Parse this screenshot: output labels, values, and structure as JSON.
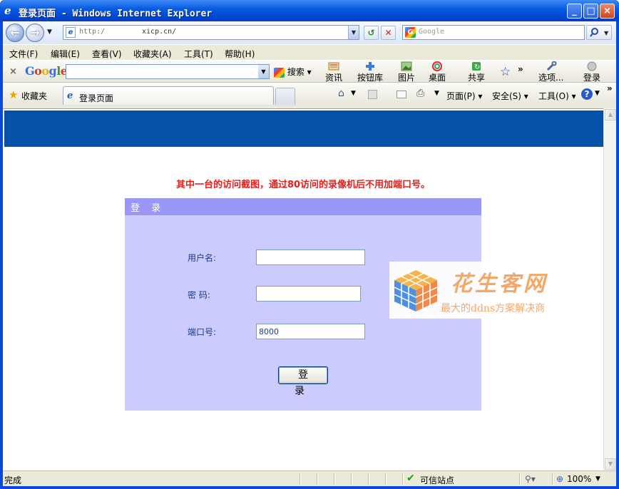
{
  "window": {
    "title": "登录页面 - Windows Internet Explorer",
    "controls": [
      "_",
      "□",
      "×"
    ]
  },
  "address_bar": {
    "url_prefix": "http:/",
    "url_host": "xicp.cn/",
    "search_placeholder": "Google"
  },
  "menu": {
    "items": [
      "文件(F)",
      "编辑(E)",
      "查看(V)",
      "收藏夹(A)",
      "工具(T)",
      "帮助(H)"
    ]
  },
  "google_toolbar": {
    "logo": "Google",
    "search_label": "搜索",
    "buttons": [
      "资讯",
      "按钮库",
      "图片",
      "桌面",
      "共享",
      "选项...",
      "登录"
    ]
  },
  "favorites_bar": {
    "favorites_label": "收藏夹",
    "tab_label": "登录页面",
    "tools": [
      "页面(P)",
      "安全(S)",
      "工具(O)"
    ]
  },
  "page": {
    "notice": "其中一台的访问截图，通过80访问的录像机后不用加端口号。",
    "login_header": "登 录",
    "username_label": "用户名:",
    "password_label": "密  码:",
    "port_label": "端口号:",
    "username_value": "",
    "password_value": "",
    "port_value": "8000",
    "login_button": "登 录"
  },
  "watermark": {
    "brand": "花生客网",
    "slogan": "最大的ddns方案解决商"
  },
  "status_bar": {
    "status": "完成",
    "zone": "可信站点",
    "zoom": "100%"
  },
  "colors": {
    "banner": "#0452a8",
    "panel": "#cccbfe",
    "panel_header": "#9a97f8",
    "notice": "#e5201c"
  }
}
